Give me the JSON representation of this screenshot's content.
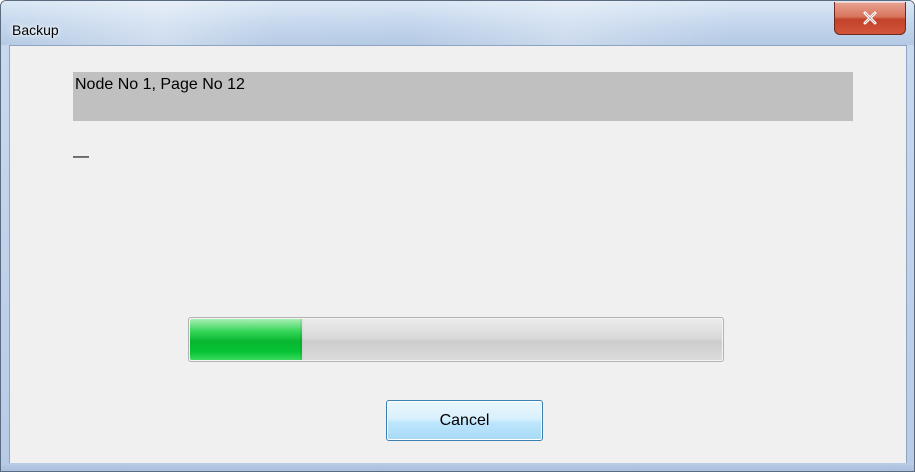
{
  "window": {
    "title": "Backup",
    "close_icon": "close-x-icon",
    "close_color": "#c2412a"
  },
  "dialog": {
    "status_text": "Node No 1, Page No 12",
    "secondary_text": "—",
    "progress": {
      "fraction": 0.21,
      "color": "#08b730"
    },
    "cancel_label": "Cancel"
  }
}
